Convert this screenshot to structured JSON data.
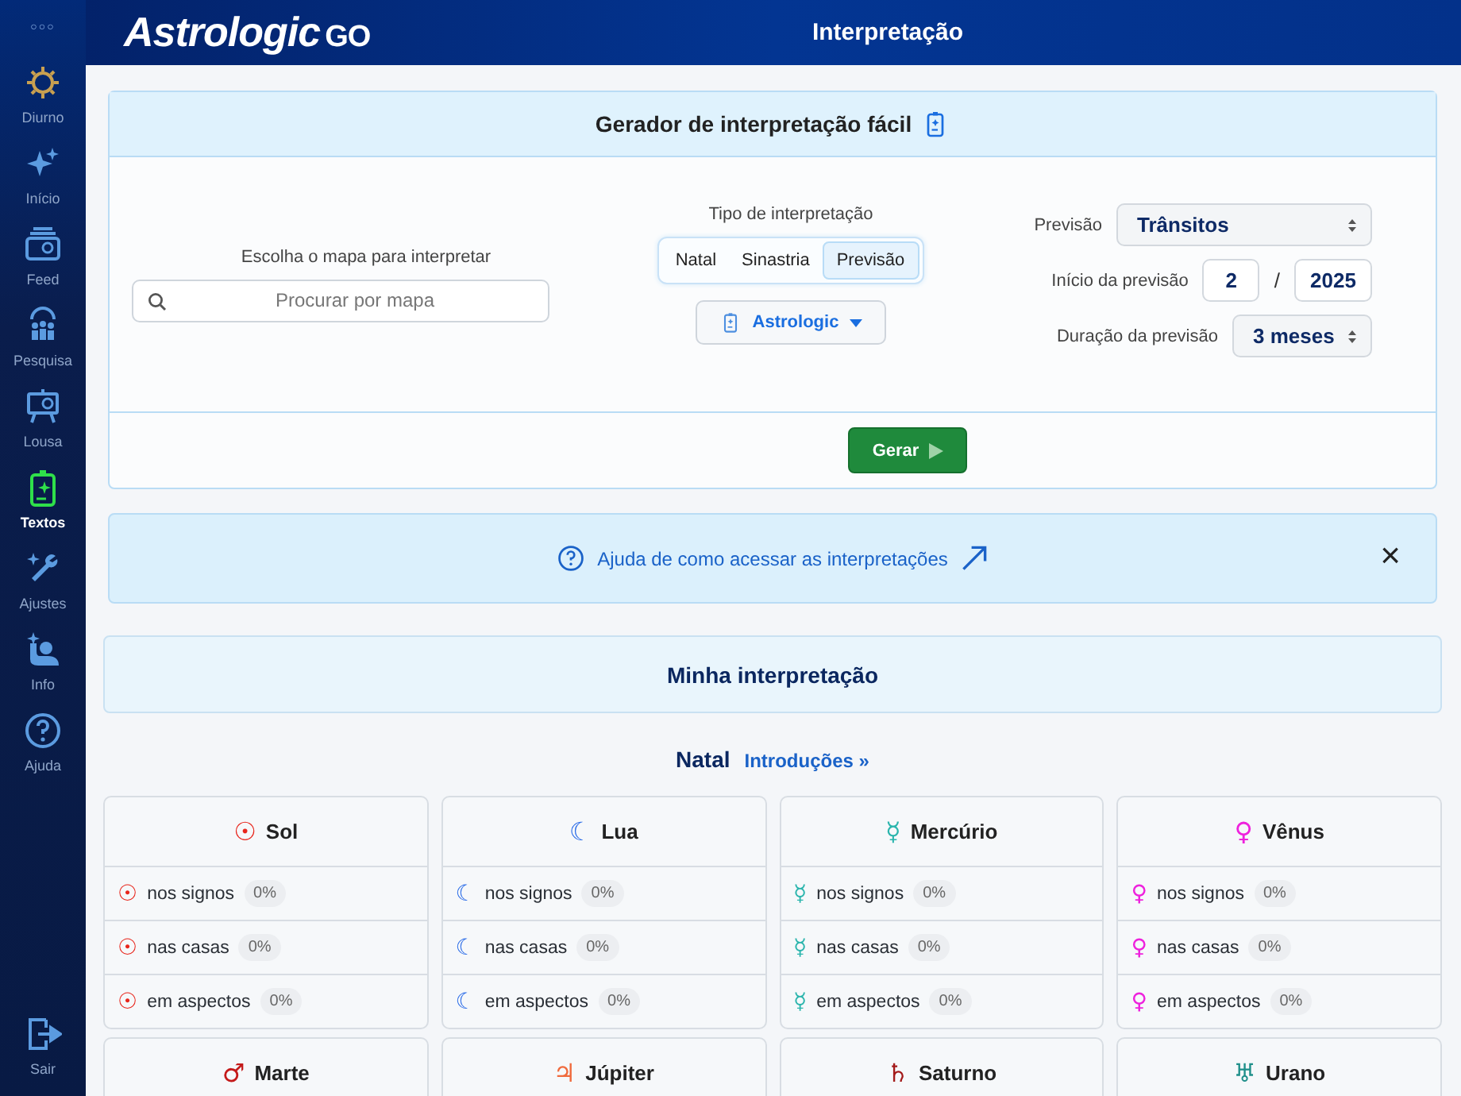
{
  "sidebar": {
    "more": "○○○",
    "items": [
      {
        "label": "Diurno",
        "selected": false
      },
      {
        "label": "Início",
        "selected": false
      },
      {
        "label": "Feed",
        "selected": false
      },
      {
        "label": "Pesquisa",
        "selected": false
      },
      {
        "label": "Lousa",
        "selected": false
      },
      {
        "label": "Textos",
        "selected": true
      },
      {
        "label": "Ajustes",
        "selected": false
      },
      {
        "label": "Info",
        "selected": false
      },
      {
        "label": "Ajuda",
        "selected": false
      }
    ],
    "logout": "Sair"
  },
  "header": {
    "logo": "Astrologic",
    "logo_suffix": "GO",
    "title": "Interpretação"
  },
  "generator": {
    "title": "Gerador de interpretação fácil",
    "chart_label": "Escolha o mapa para interpretar",
    "search": {
      "placeholder": "Procurar por mapa"
    },
    "type_label": "Tipo de interpretação",
    "tabs": [
      {
        "label": "Natal",
        "selected": false
      },
      {
        "label": "Sinastria",
        "selected": false
      },
      {
        "label": "Previsão",
        "selected": true
      }
    ],
    "source": "Astrologic",
    "forecast_label": "Previsão",
    "forecast_value": "Trânsitos",
    "start_label": "Início da previsão",
    "start_month": "2",
    "separator": "/",
    "start_year": "2025",
    "duration_label": "Duração da previsão",
    "duration_value": "3 meses",
    "button": "Gerar"
  },
  "help": {
    "text": "Ajuda de como acessar as interpretações",
    "close": "×"
  },
  "my_interpretation": {
    "title": "Minha interpretação"
  },
  "section": {
    "title": "Natal",
    "link": "Introduções »"
  },
  "planets": [
    {
      "symbol": "☉",
      "name": "Sol",
      "color": "#e8261c",
      "rows": [
        {
          "label": "nos signos",
          "value": "0%"
        },
        {
          "label": "nas casas",
          "value": "0%"
        },
        {
          "label": "em aspectos",
          "value": "0%"
        }
      ]
    },
    {
      "symbol": "☾",
      "name": "Lua",
      "color": "#2f6fe8",
      "rows": [
        {
          "label": "nos signos",
          "value": "0%"
        },
        {
          "label": "nas casas",
          "value": "0%"
        },
        {
          "label": "em aspectos",
          "value": "0%"
        }
      ]
    },
    {
      "symbol": "☿",
      "name": "Mercúrio",
      "color": "#2bb5ad",
      "rows": [
        {
          "label": "nos signos",
          "value": "0%"
        },
        {
          "label": "nas casas",
          "value": "0%"
        },
        {
          "label": "em aspectos",
          "value": "0%"
        }
      ]
    },
    {
      "symbol": "♀",
      "name": "Vênus",
      "color": "#ee22dd",
      "rows": [
        {
          "label": "nos signos",
          "value": "0%"
        },
        {
          "label": "nas casas",
          "value": "0%"
        },
        {
          "label": "em aspectos",
          "value": "0%"
        }
      ]
    },
    {
      "symbol": "♂",
      "name": "Marte",
      "color": "#c41a1a"
    },
    {
      "symbol": "♃",
      "name": "Júpiter",
      "color": "#f06a3c"
    },
    {
      "symbol": "♄",
      "name": "Saturno",
      "color": "#a31a1a"
    },
    {
      "symbol": "♅",
      "name": "Urano",
      "color": "#1f8f8a"
    }
  ]
}
